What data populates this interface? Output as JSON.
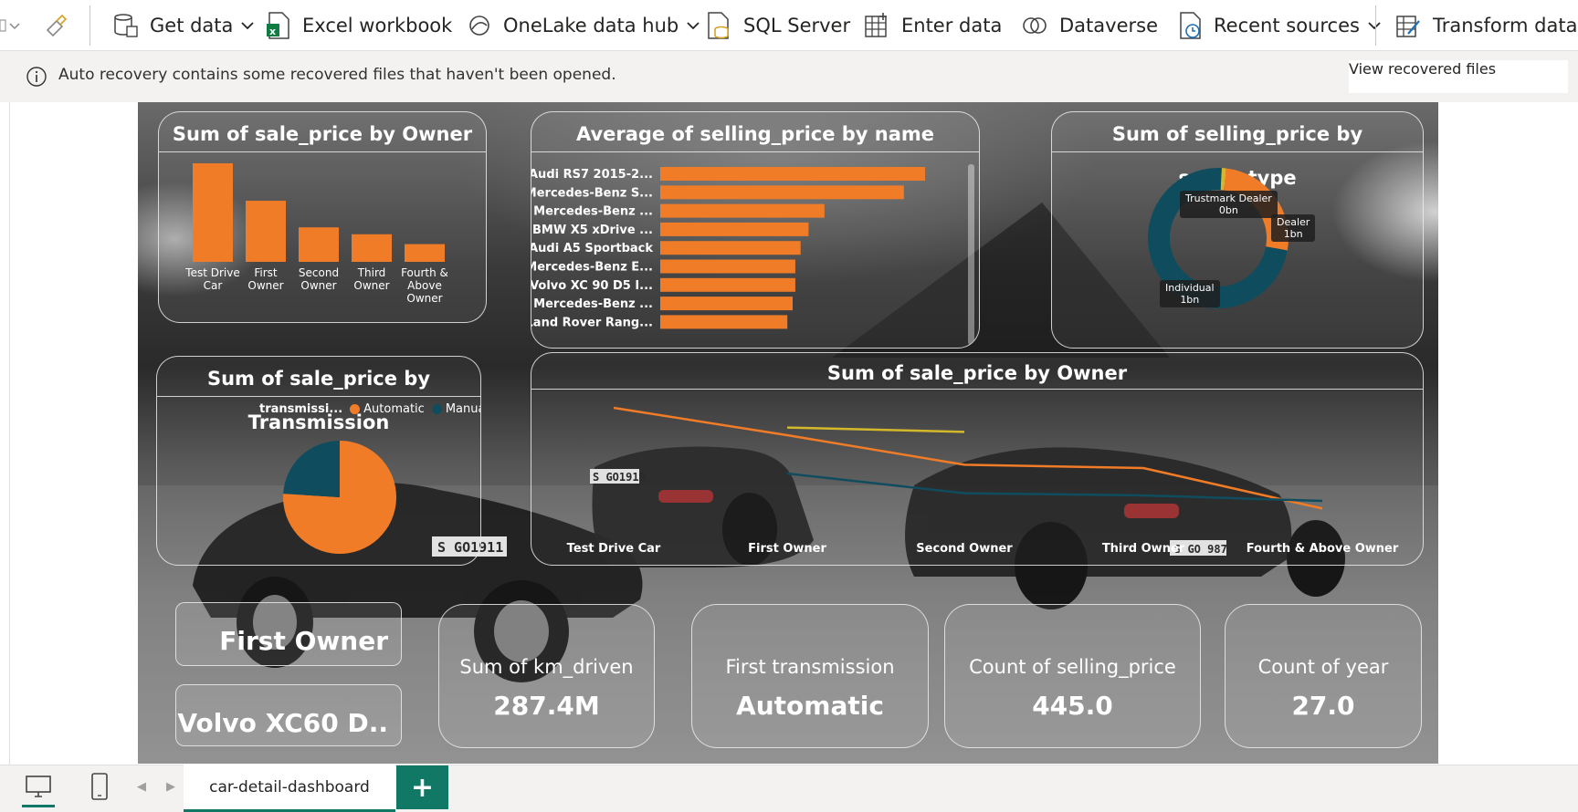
{
  "ribbon": {
    "get_data": "Get data",
    "excel_workbook": "Excel workbook",
    "onelake": "OneLake data hub",
    "sql_server": "SQL Server",
    "enter_data": "Enter data",
    "dataverse": "Dataverse",
    "recent_sources": "Recent sources",
    "transform_data": "Transform data"
  },
  "notice": {
    "message": "Auto recovery contains some recovered files that haven't been opened.",
    "button": "View recovered files"
  },
  "colors": {
    "orange": "#f07c28",
    "teal": "#0f4d5e",
    "yellow": "#d4b82a",
    "brand": "#117865"
  },
  "visuals": {
    "owner_bar": {
      "title": "Sum of sale_price by Owner",
      "chart_data": {
        "type": "bar",
        "categories": [
          "Test Drive Car",
          "First Owner",
          "Second Owner",
          "Third Owner",
          "Fourth & Above Owner"
        ],
        "category_lines": [
          [
            "Test Drive",
            "Car"
          ],
          [
            "First",
            "Owner"
          ],
          [
            "Second",
            "Owner"
          ],
          [
            "Third",
            "Owner"
          ],
          [
            "Fourth &",
            "Above",
            "Owner"
          ]
        ],
        "values": [
          100,
          62,
          35,
          28,
          18
        ],
        "ylim": [
          0,
          100
        ]
      }
    },
    "avg_by_name": {
      "title": "Average of selling_price by name",
      "chart_data": {
        "type": "bar",
        "orientation": "horizontal",
        "categories": [
          "Audi RS7 2015-2...",
          "Mercedes-Benz S...",
          "Mercedes-Benz ...",
          "BMW X5 xDrive ...",
          "Audi A5 Sportback",
          "Mercedes-Benz E...",
          "Volvo XC 90 D5 I...",
          "Mercedes-Benz ...",
          "Land Rover Rang..."
        ],
        "values": [
          100,
          92,
          62,
          56,
          53,
          51,
          51,
          50,
          48
        ],
        "xlim": [
          0,
          100
        ]
      }
    },
    "seller_type": {
      "title": "Sum of selling_price by seller_type",
      "chart_data": {
        "type": "pie",
        "donut": true,
        "series": [
          {
            "name": "Individual",
            "value": 73,
            "label": "1bn",
            "color": "#0f4d5e"
          },
          {
            "name": "Dealer",
            "value": 26,
            "label": "1bn",
            "color": "#f07c28"
          },
          {
            "name": "Trustmark Dealer",
            "value": 1,
            "label": "0bn",
            "color": "#d4b82a"
          }
        ]
      }
    },
    "transmission": {
      "title": "Sum of sale_price by Transmission",
      "legend_title": "transmissi...",
      "chart_data": {
        "type": "pie",
        "series": [
          {
            "name": "Automatic",
            "value": 76,
            "color": "#f07c28"
          },
          {
            "name": "Manual",
            "value": 24,
            "color": "#0f4d5e"
          }
        ]
      }
    },
    "owner_line": {
      "title": "Sum of sale_price by Owner",
      "chart_data": {
        "type": "line",
        "categories": [
          "Test Drive Car",
          "First Owner",
          "Second Owner",
          "Third Owner",
          "Fourth & Above Owner"
        ],
        "series": [
          {
            "color": "#f07c28",
            "values": [
              100,
              75,
              48,
              45,
              8
            ]
          },
          {
            "color": "#0f4d5e",
            "values": [
              null,
              40,
              22,
              20,
              15
            ]
          },
          {
            "color": "#d4b82a",
            "values": [
              null,
              82,
              78,
              null,
              null
            ]
          }
        ],
        "ylim": [
          0,
          110
        ]
      }
    },
    "slicers": [
      "First Owner",
      "Volvo XC60 D.."
    ],
    "kpis": [
      {
        "label": "Sum of km_driven",
        "value": "287.4M"
      },
      {
        "label": "First transmission",
        "value": "Automatic"
      },
      {
        "label": "Count of selling_price",
        "value": "445.0"
      },
      {
        "label": "Count of year",
        "value": "27.0"
      }
    ]
  },
  "pages": {
    "active": "car-detail-dashboard",
    "add": "+"
  }
}
